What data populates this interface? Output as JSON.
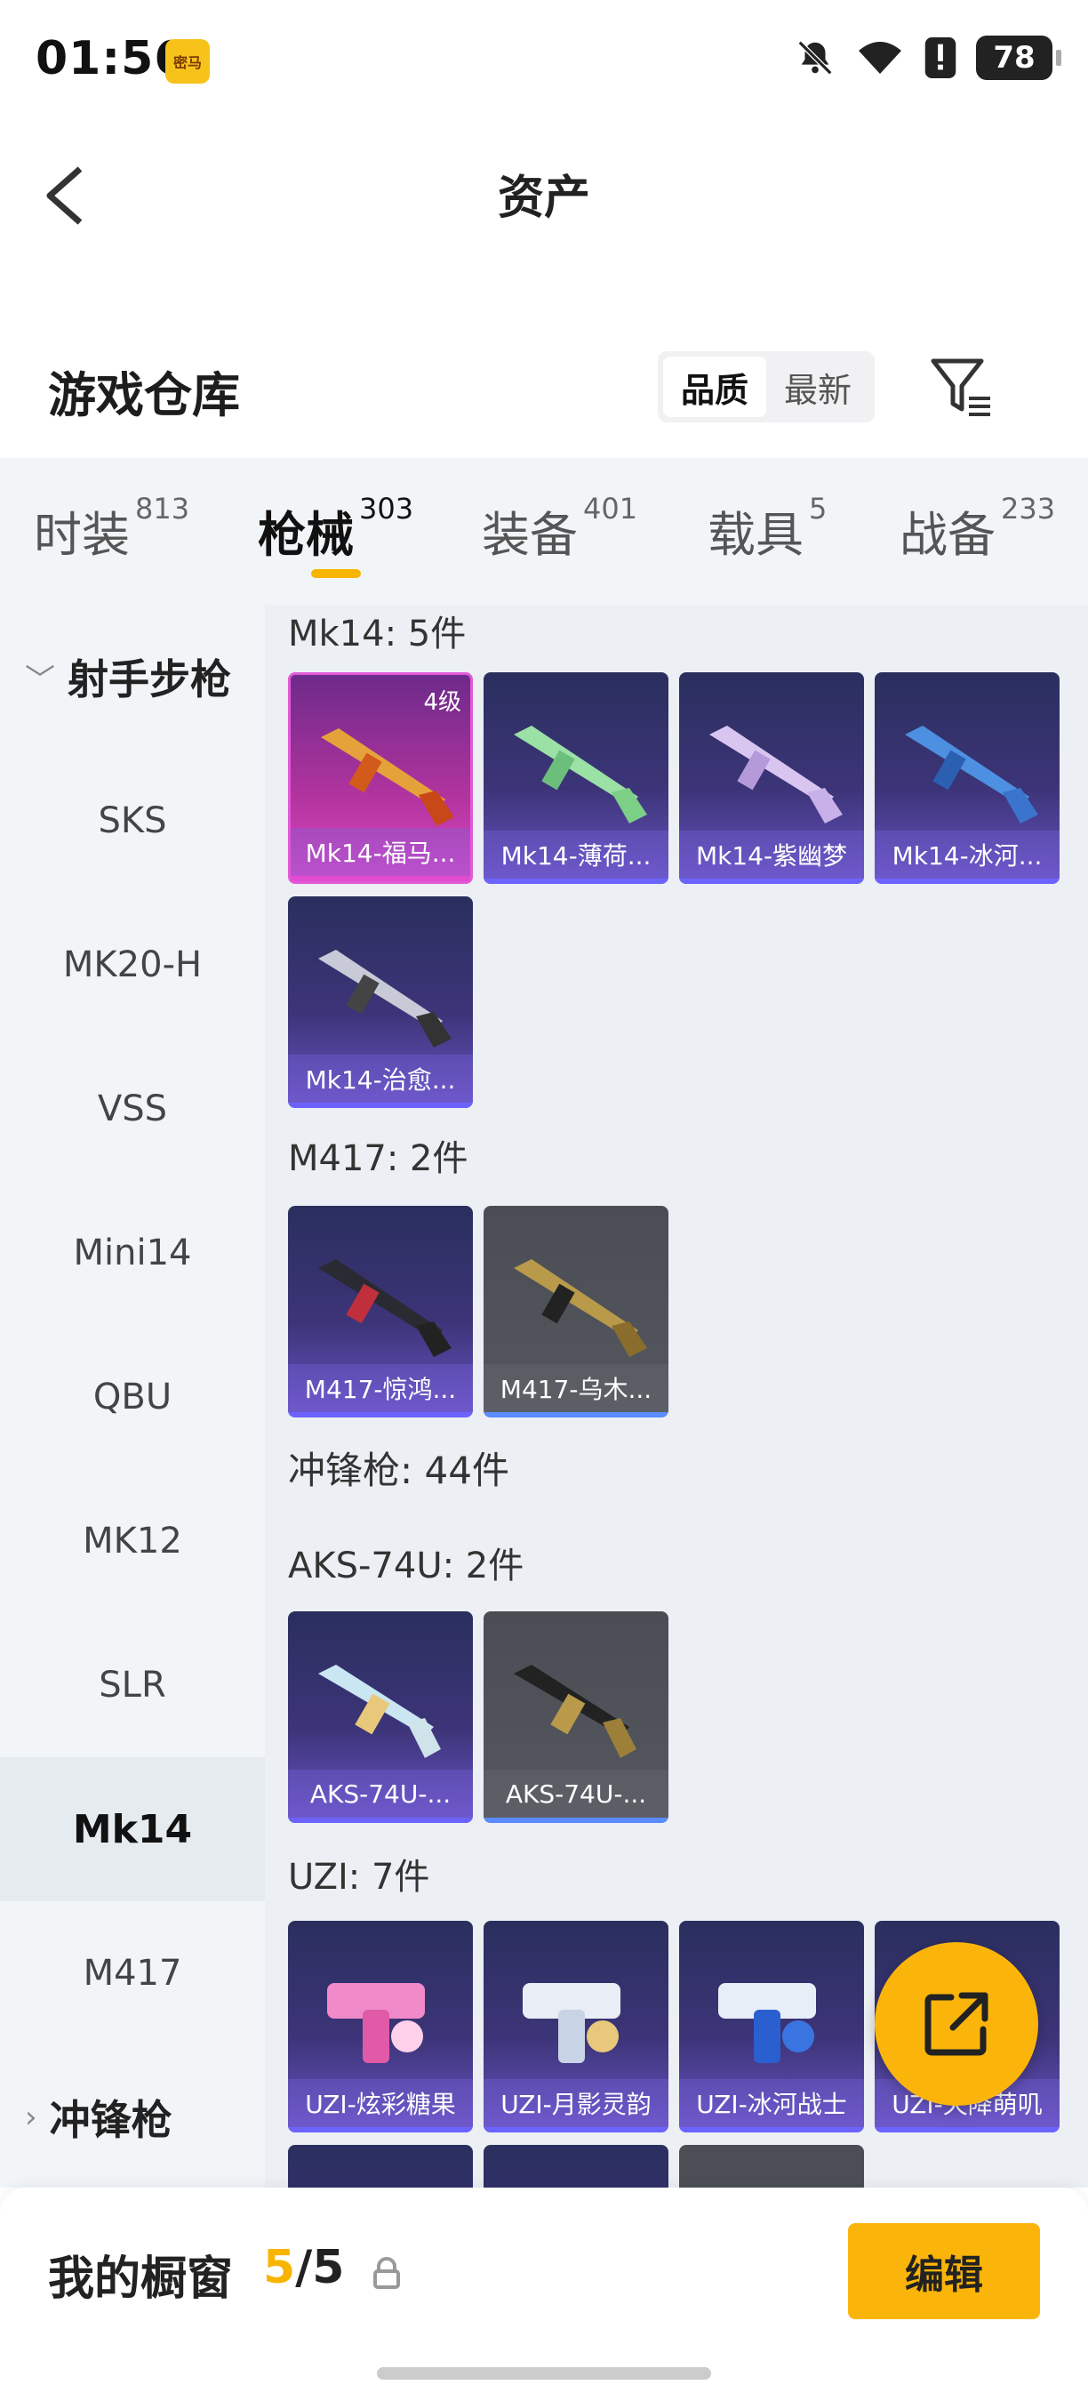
{
  "status_bar": {
    "time": "01:56",
    "app_badge": "密马",
    "battery": "78"
  },
  "header": {
    "title": "资产"
  },
  "warehouse": {
    "title": "游戏仓库",
    "sort_options": [
      {
        "label": "品质",
        "active": true
      },
      {
        "label": "最新",
        "active": false
      }
    ]
  },
  "category_tabs": [
    {
      "label": "时装",
      "count": "813"
    },
    {
      "label": "枪械",
      "count": "303",
      "active": true
    },
    {
      "label": "装备",
      "count": "401"
    },
    {
      "label": "载具",
      "count": "5"
    },
    {
      "label": "战备",
      "count": "233"
    }
  ],
  "side_list": [
    {
      "label": "射手步枪",
      "type": "group",
      "chevron": "﹀"
    },
    {
      "label": "SKS"
    },
    {
      "label": "MK20-H"
    },
    {
      "label": "VSS"
    },
    {
      "label": "Mini14"
    },
    {
      "label": "QBU"
    },
    {
      "label": "MK12"
    },
    {
      "label": "SLR"
    },
    {
      "label": "Mk14",
      "active": true
    },
    {
      "label": "M417"
    },
    {
      "label": "冲锋枪",
      "type": "group",
      "chevron": "›"
    }
  ],
  "sections": [
    {
      "title": "Mk14: 5件"
    },
    {
      "title": "M417: 2件"
    },
    {
      "title": "冲锋枪: 44件"
    },
    {
      "title": "AKS-74U: 2件"
    },
    {
      "title": "UZI: 7件"
    }
  ],
  "items": [
    {
      "name": "Mk14-福马...",
      "level": "4级",
      "style": "pink"
    },
    {
      "name": "Mk14-薄荷...",
      "style": "purple"
    },
    {
      "name": "Mk14-紫幽梦",
      "style": "purple"
    },
    {
      "name": "Mk14-冰河...",
      "style": "purple"
    },
    {
      "name": "Mk14-治愈...",
      "style": "purple"
    },
    {
      "name": "M417-惊鸿...",
      "style": "purple"
    },
    {
      "name": "M417-乌木...",
      "style": "gray"
    },
    {
      "name": "AKS-74U-...",
      "style": "purple"
    },
    {
      "name": "AKS-74U-...",
      "style": "gray"
    },
    {
      "name": "UZI-炫彩糖果",
      "style": "purple"
    },
    {
      "name": "UZI-月影灵韵",
      "style": "purple"
    },
    {
      "name": "UZI-冰河战士",
      "style": "purple"
    },
    {
      "name": "UZI-天降萌叽",
      "style": "purple"
    }
  ],
  "bottom_bar": {
    "showcase_label": "我的橱窗",
    "showcase_current": "5",
    "showcase_sep": "/",
    "showcase_total": "5",
    "edit_label": "编辑"
  },
  "colors": {
    "accent": "#fbb50a",
    "tab_indicator": "#f7b500",
    "side_bg": "#f2f5f8",
    "grid_bg": "#eceff3"
  }
}
